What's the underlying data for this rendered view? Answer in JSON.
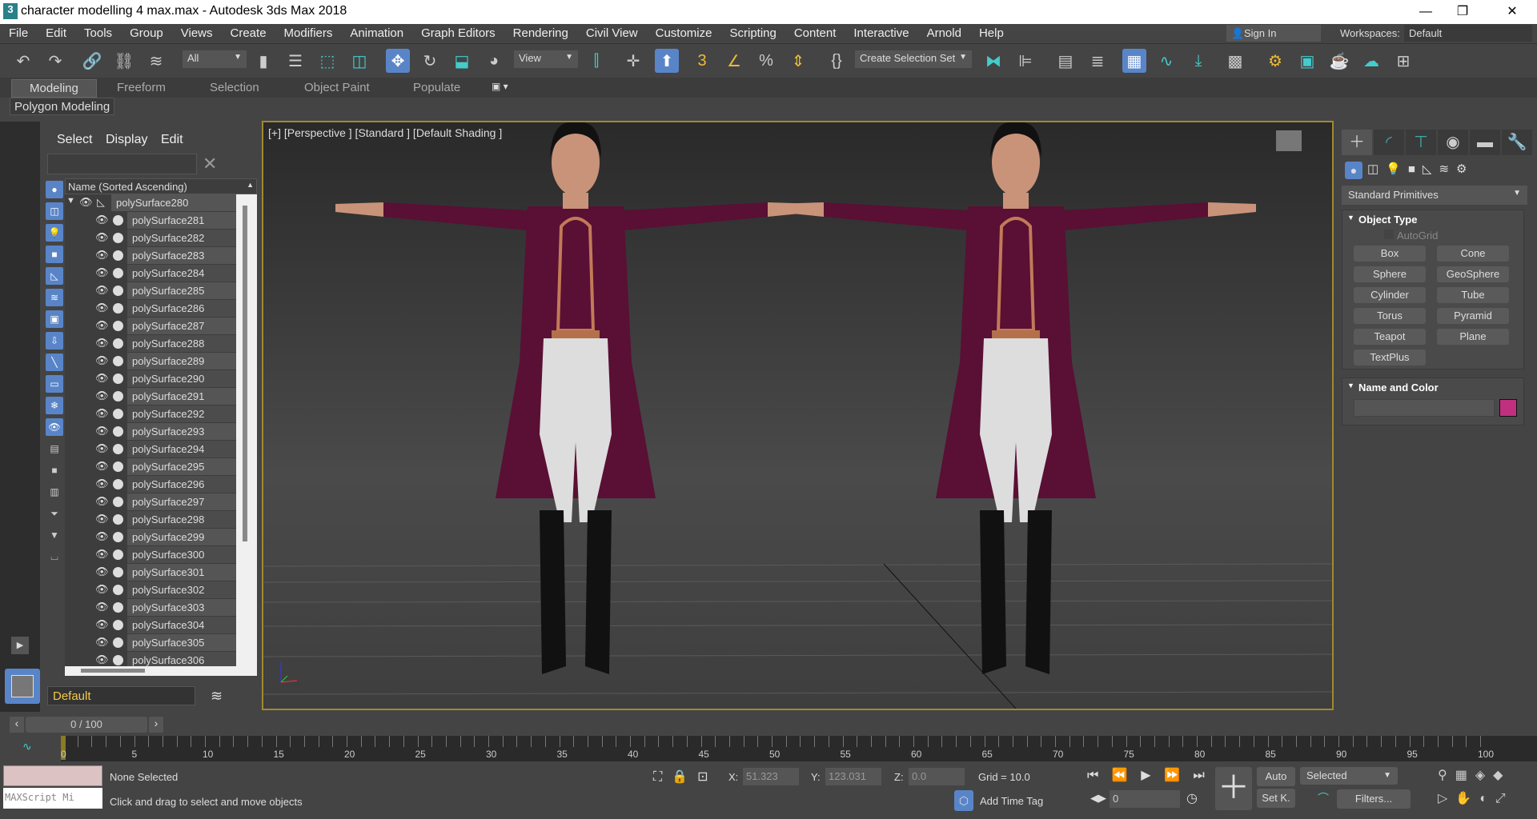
{
  "window": {
    "title": "character modelling 4 max.max - Autodesk 3ds Max 2018",
    "app_icon": "3"
  },
  "menu": [
    "File",
    "Edit",
    "Tools",
    "Group",
    "Views",
    "Create",
    "Modifiers",
    "Animation",
    "Graph Editors",
    "Rendering",
    "Civil View",
    "Customize",
    "Scripting",
    "Content",
    "Interactive",
    "Arnold",
    "Help"
  ],
  "account": {
    "sign_in": "Sign In",
    "workspaces_label": "Workspaces:",
    "workspace": "Default"
  },
  "toolbar": {
    "filter": "All",
    "coord": "View",
    "selection_set": "Create Selection Set",
    "active_tool": "select-and-move"
  },
  "ribbon": {
    "tabs": [
      "Modeling",
      "Freeform",
      "Selection",
      "Object Paint",
      "Populate"
    ],
    "active": "Modeling",
    "panel": "Polygon Modeling"
  },
  "explorer": {
    "tabs": [
      "Select",
      "Display",
      "Edit"
    ],
    "column": "Name (Sorted Ascending)",
    "parent": "polySurface280",
    "items": [
      "polySurface281",
      "polySurface282",
      "polySurface283",
      "polySurface284",
      "polySurface285",
      "polySurface286",
      "polySurface287",
      "polySurface288",
      "polySurface289",
      "polySurface290",
      "polySurface291",
      "polySurface292",
      "polySurface293",
      "polySurface294",
      "polySurface295",
      "polySurface296",
      "polySurface297",
      "polySurface298",
      "polySurface299",
      "polySurface300",
      "polySurface301",
      "polySurface302",
      "polySurface303",
      "polySurface304",
      "polySurface305",
      "polySurface306"
    ],
    "layer": "Default"
  },
  "viewport": {
    "label": "[+] [Perspective ] [Standard ] [Default Shading ]"
  },
  "command_panel": {
    "category": "Standard Primitives",
    "object_type": "Object Type",
    "autogrid": "AutoGrid",
    "buttons": [
      "Box",
      "Cone",
      "Sphere",
      "GeoSphere",
      "Cylinder",
      "Tube",
      "Torus",
      "Pyramid",
      "Teapot",
      "Plane",
      "TextPlus"
    ],
    "name_and_color": "Name and Color",
    "object_color": "#c0307e"
  },
  "timeline": {
    "frame": "0 / 100",
    "ticks": [
      "0",
      "5",
      "10",
      "15",
      "20",
      "25",
      "30",
      "35",
      "40",
      "45",
      "50",
      "55",
      "60",
      "65",
      "70",
      "75",
      "80",
      "85",
      "90",
      "95",
      "100"
    ]
  },
  "status": {
    "selection": "None Selected",
    "prompt": "Click and drag to select and move objects",
    "maxscript": "MAXScript Mi",
    "x_label": "X:",
    "x": "51.323",
    "y_label": "Y:",
    "y": "123.031",
    "z_label": "Z:",
    "z": "0.0",
    "grid": "Grid = 10.0",
    "time_tag": "Add Time Tag",
    "current_frame": "0",
    "auto": "Auto",
    "set_key": "Set K.",
    "key_filter": "Selected",
    "filters": "Filters..."
  },
  "colors": {
    "accent": "#5985c8",
    "viewport_border": "#a08a30",
    "coat": "#5a0f34"
  }
}
